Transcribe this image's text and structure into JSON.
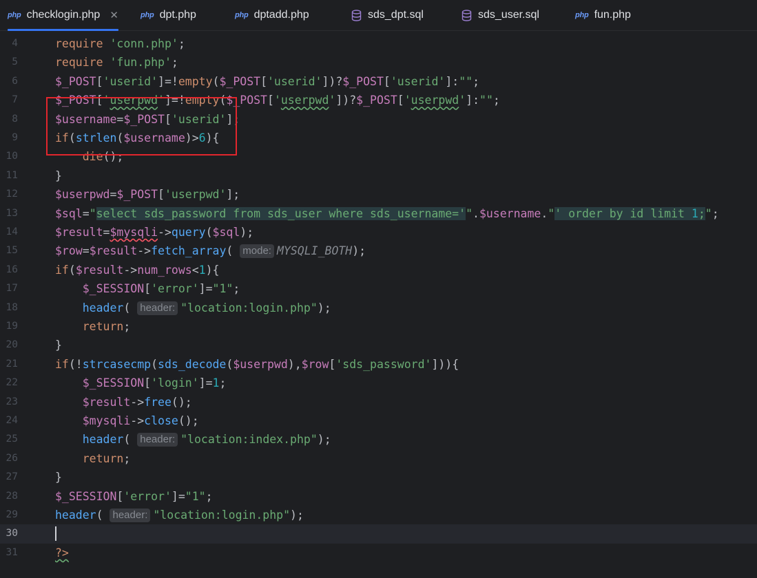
{
  "tabs": [
    {
      "label": "checklogin.php",
      "icon": "php-file-icon",
      "icon_text": "php",
      "active": true,
      "closable": true
    },
    {
      "label": "dpt.php",
      "icon": "php-file-icon",
      "icon_text": "php"
    },
    {
      "label": "dptadd.php",
      "icon": "php-file-icon",
      "icon_text": "php"
    },
    {
      "label": "sds_dpt.sql",
      "icon": "database-icon"
    },
    {
      "label": "sds_user.sql",
      "icon": "database-icon"
    },
    {
      "label": "fun.php",
      "icon": "php-file-icon",
      "icon_text": "php"
    }
  ],
  "close_glyph": "✕",
  "editor": {
    "current_line": "30",
    "hints": {
      "mode": "mode:",
      "header": "header:"
    },
    "lines": [
      {
        "num": "4",
        "parts": [
          [
            "k",
            "require "
          ],
          [
            "s",
            "'conn.php'"
          ],
          [
            "pl",
            ";"
          ]
        ]
      },
      {
        "num": "5",
        "parts": [
          [
            "k",
            "require "
          ],
          [
            "s",
            "'fun.php'"
          ],
          [
            "pl",
            ";"
          ]
        ]
      },
      {
        "num": "6",
        "parts": [
          [
            "v",
            "$_POST"
          ],
          [
            "pl",
            "["
          ],
          [
            "s",
            "'userid'"
          ],
          [
            "pl",
            "]=!"
          ],
          [
            "k",
            "empty"
          ],
          [
            "pl",
            "("
          ],
          [
            "v",
            "$_POST"
          ],
          [
            "pl",
            "["
          ],
          [
            "s",
            "'userid'"
          ],
          [
            "pl",
            "])?"
          ],
          [
            "v",
            "$_POST"
          ],
          [
            "pl",
            "["
          ],
          [
            "s",
            "'userid'"
          ],
          [
            "pl",
            "]:"
          ],
          [
            "s",
            "\"\""
          ],
          [
            "pl",
            ";"
          ]
        ]
      },
      {
        "num": "7",
        "parts": [
          [
            "v",
            "$_POST"
          ],
          [
            "pl",
            "["
          ],
          [
            "s",
            "'"
          ],
          [
            "s wavyg",
            "userpwd"
          ],
          [
            "s",
            "'"
          ],
          [
            "pl",
            "]=!"
          ],
          [
            "k",
            "empty"
          ],
          [
            "pl",
            "("
          ],
          [
            "v",
            "$_POST"
          ],
          [
            "pl",
            "["
          ],
          [
            "s",
            "'"
          ],
          [
            "s wavyg",
            "userpwd"
          ],
          [
            "s",
            "'"
          ],
          [
            "pl",
            "])?"
          ],
          [
            "v",
            "$_POST"
          ],
          [
            "pl",
            "["
          ],
          [
            "s",
            "'"
          ],
          [
            "s wavyg",
            "userpwd"
          ],
          [
            "s",
            "'"
          ],
          [
            "pl",
            "]:"
          ],
          [
            "s",
            "\"\""
          ],
          [
            "pl",
            ";"
          ]
        ]
      },
      {
        "num": "8",
        "parts": [
          [
            "v",
            "$username"
          ],
          [
            "pl",
            "="
          ],
          [
            "v",
            "$_POST"
          ],
          [
            "pl",
            "["
          ],
          [
            "s",
            "'userid'"
          ],
          [
            "pl",
            "];"
          ]
        ]
      },
      {
        "num": "9",
        "parts": [
          [
            "k",
            "if"
          ],
          [
            "pl",
            "("
          ],
          [
            "f",
            "strlen"
          ],
          [
            "pl",
            "("
          ],
          [
            "v",
            "$username"
          ],
          [
            "pl",
            ")>"
          ],
          [
            "n",
            "6"
          ],
          [
            "pl",
            "){"
          ]
        ]
      },
      {
        "num": "10",
        "parts": [
          [
            "pl",
            "    "
          ],
          [
            "k",
            "die"
          ],
          [
            "pl",
            "();"
          ]
        ]
      },
      {
        "num": "11",
        "parts": [
          [
            "pl",
            "}"
          ]
        ]
      },
      {
        "num": "12",
        "parts": [
          [
            "v",
            "$userpwd"
          ],
          [
            "pl",
            "="
          ],
          [
            "v",
            "$_POST"
          ],
          [
            "pl",
            "["
          ],
          [
            "s",
            "'userpwd'"
          ],
          [
            "pl",
            "];"
          ]
        ]
      },
      {
        "num": "13",
        "parts": [
          [
            "v",
            "$sql"
          ],
          [
            "pl",
            "="
          ],
          [
            "s",
            "\""
          ],
          [
            "s sqlbg",
            "select sds_password from sds_user where sds_username='"
          ],
          [
            "s",
            "\""
          ],
          [
            "pl",
            "."
          ],
          [
            "v",
            "$username"
          ],
          [
            "pl",
            "."
          ],
          [
            "s",
            "\""
          ],
          [
            "s sqlbg",
            "' order by id limit "
          ],
          [
            "n sqlbg",
            "1"
          ],
          [
            "s sqlbg",
            ";"
          ],
          [
            "s",
            "\""
          ],
          [
            "pl",
            ";"
          ]
        ]
      },
      {
        "num": "14",
        "parts": [
          [
            "v",
            "$result"
          ],
          [
            "pl",
            "="
          ],
          [
            "v wavy",
            "$mysqli"
          ],
          [
            "pl",
            "->"
          ],
          [
            "f",
            "query"
          ],
          [
            "pl",
            "("
          ],
          [
            "v",
            "$sql"
          ],
          [
            "pl",
            ");"
          ]
        ]
      },
      {
        "num": "15",
        "parts": [
          [
            "v",
            "$row"
          ],
          [
            "pl",
            "="
          ],
          [
            "v",
            "$result"
          ],
          [
            "pl",
            "->"
          ],
          [
            "f",
            "fetch_array"
          ],
          [
            "pl",
            "( "
          ],
          [
            "hint",
            "mode"
          ],
          [
            "hint-text",
            "MYSQLI_BOTH"
          ],
          [
            "pl",
            ");"
          ]
        ]
      },
      {
        "num": "16",
        "parts": [
          [
            "k",
            "if"
          ],
          [
            "pl",
            "("
          ],
          [
            "v",
            "$result"
          ],
          [
            "pl",
            "->"
          ],
          [
            "v",
            "num_rows"
          ],
          [
            "pl",
            "<"
          ],
          [
            "n",
            "1"
          ],
          [
            "pl",
            "){"
          ]
        ]
      },
      {
        "num": "17",
        "parts": [
          [
            "pl",
            "    "
          ],
          [
            "v",
            "$_SESSION"
          ],
          [
            "pl",
            "["
          ],
          [
            "s",
            "'error'"
          ],
          [
            "pl",
            "]="
          ],
          [
            "s",
            "\"1\""
          ],
          [
            "pl",
            ";"
          ]
        ]
      },
      {
        "num": "18",
        "parts": [
          [
            "pl",
            "    "
          ],
          [
            "f",
            "header"
          ],
          [
            "pl",
            "( "
          ],
          [
            "hint",
            "header"
          ],
          [
            "s",
            "\"location:login.php\""
          ],
          [
            "pl",
            ");"
          ]
        ]
      },
      {
        "num": "19",
        "parts": [
          [
            "pl",
            "    "
          ],
          [
            "k",
            "return"
          ],
          [
            "pl",
            ";"
          ]
        ]
      },
      {
        "num": "20",
        "parts": [
          [
            "pl",
            "}"
          ]
        ]
      },
      {
        "num": "21",
        "parts": [
          [
            "k",
            "if"
          ],
          [
            "pl",
            "(!"
          ],
          [
            "f",
            "strcasecmp"
          ],
          [
            "pl",
            "("
          ],
          [
            "f",
            "sds_decode"
          ],
          [
            "pl",
            "("
          ],
          [
            "v",
            "$userpwd"
          ],
          [
            "pl",
            "),"
          ],
          [
            "v",
            "$row"
          ],
          [
            "pl",
            "["
          ],
          [
            "s",
            "'sds_password'"
          ],
          [
            "pl",
            "])){"
          ]
        ]
      },
      {
        "num": "22",
        "parts": [
          [
            "pl",
            "    "
          ],
          [
            "v",
            "$_SESSION"
          ],
          [
            "pl",
            "["
          ],
          [
            "s",
            "'login'"
          ],
          [
            "pl",
            "]="
          ],
          [
            "n",
            "1"
          ],
          [
            "pl",
            ";"
          ]
        ]
      },
      {
        "num": "23",
        "parts": [
          [
            "pl",
            "    "
          ],
          [
            "v",
            "$result"
          ],
          [
            "pl",
            "->"
          ],
          [
            "f",
            "free"
          ],
          [
            "pl",
            "();"
          ]
        ]
      },
      {
        "num": "24",
        "parts": [
          [
            "pl",
            "    "
          ],
          [
            "v",
            "$mysqli"
          ],
          [
            "pl",
            "->"
          ],
          [
            "f",
            "close"
          ],
          [
            "pl",
            "();"
          ]
        ]
      },
      {
        "num": "25",
        "parts": [
          [
            "pl",
            "    "
          ],
          [
            "f",
            "header"
          ],
          [
            "pl",
            "( "
          ],
          [
            "hint",
            "header"
          ],
          [
            "s",
            "\"location:index.php\""
          ],
          [
            "pl",
            ");"
          ]
        ]
      },
      {
        "num": "26",
        "parts": [
          [
            "pl",
            "    "
          ],
          [
            "k",
            "return"
          ],
          [
            "pl",
            ";"
          ]
        ]
      },
      {
        "num": "27",
        "parts": [
          [
            "pl",
            "}"
          ]
        ]
      },
      {
        "num": "28",
        "parts": [
          [
            "v",
            "$_SESSION"
          ],
          [
            "pl",
            "["
          ],
          [
            "s",
            "'error'"
          ],
          [
            "pl",
            "]="
          ],
          [
            "s",
            "\"1\""
          ],
          [
            "pl",
            ";"
          ]
        ]
      },
      {
        "num": "29",
        "parts": [
          [
            "f",
            "header"
          ],
          [
            "pl",
            "( "
          ],
          [
            "hint",
            "header"
          ],
          [
            "s",
            "\"location:login.php\""
          ],
          [
            "pl",
            ");"
          ]
        ]
      },
      {
        "num": "30",
        "parts": []
      },
      {
        "num": "31",
        "parts": [
          [
            "k wavyg",
            "?>"
          ]
        ]
      }
    ]
  },
  "colors": {
    "background": "#1e1f22",
    "keyword": "#cf8e6d",
    "string": "#6aab73",
    "variable": "#c77dbb",
    "function": "#56a8f5",
    "number": "#2aacb8",
    "tab_active_underline": "#3574f0",
    "annotation_box": "#e3262d"
  }
}
